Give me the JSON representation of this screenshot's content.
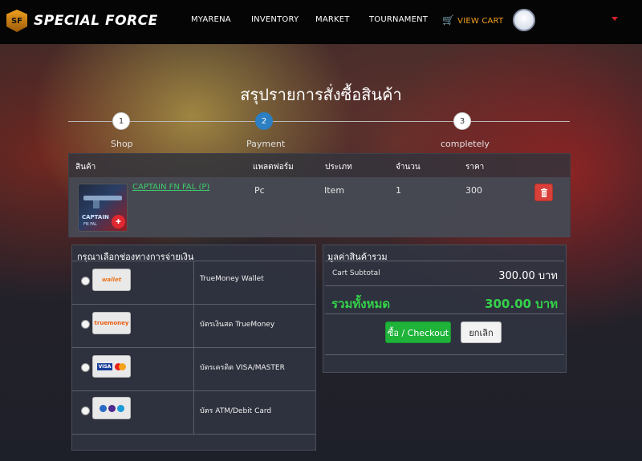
{
  "brand": {
    "logo_initials": "SF",
    "name": "SPECIAL FORCE"
  },
  "nav": {
    "items": [
      "MYARENA",
      "INVENTORY",
      "MARKET",
      "TOURNAMENT"
    ],
    "cart_label": "VIEW CART"
  },
  "page": {
    "title": "สรุปรายการสั่งซื้อสินค้า"
  },
  "steps": [
    {
      "number": "1",
      "label": "Shop"
    },
    {
      "number": "2",
      "label": "Payment"
    },
    {
      "number": "3",
      "label": "completely"
    }
  ],
  "cart": {
    "headers": [
      "สินค้า",
      "แพลตฟอร์ม",
      "ประเภท",
      "จำนวน",
      "ราคา"
    ],
    "item": {
      "name": "CAPTAIN FN FAL (P)",
      "platform": "Pc",
      "type": "Item",
      "quantity": "1",
      "price": "300",
      "thumb_caption": "CAPTAIN",
      "thumb_sub": "FN FAL"
    }
  },
  "payment": {
    "title": "กรุณาเลือกช่องทางการจ่ายเงิน",
    "methods": [
      {
        "label": "TrueMoney Wallet",
        "logo": "wallet"
      },
      {
        "label": "บัตรเงินสด TrueMoney",
        "logo": "truemoney"
      },
      {
        "label": "บัตรเครดิต VISA/MASTER",
        "logo": "VISA"
      },
      {
        "label": "บัตร ATM/Debit Card",
        "logo": "bank"
      }
    ]
  },
  "summary": {
    "title": "มูลค่าสินค้ารวม",
    "subtotal_label": "Cart Subtotal",
    "subtotal_value": "300.00 บาท",
    "total_label": "รวมทั้งหมด",
    "total_value": "300.00 บาท",
    "checkout_label": "ซื้อ / Checkout",
    "cancel_label": "ยกเลิก"
  },
  "colors": {
    "accent_green": "#34d24a",
    "checkout_green": "#1fb33a",
    "cart_orange": "#f2a01e",
    "step_active": "#2b7fc2",
    "delete_red": "#d9403a"
  }
}
